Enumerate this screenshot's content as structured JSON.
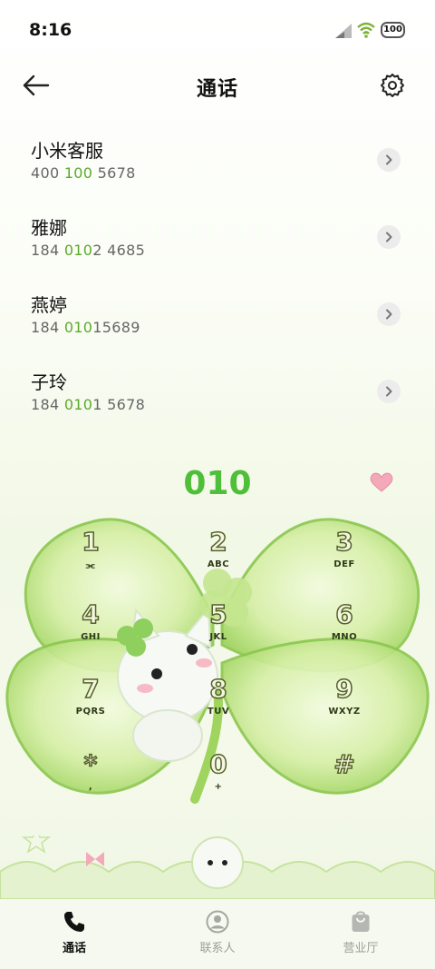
{
  "status_bar": {
    "time": "8:16",
    "battery": "100"
  },
  "header": {
    "title": "通话"
  },
  "contacts": [
    {
      "name": "小米客服",
      "number_pre": "400 ",
      "number_hl": "100",
      "number_post": " 5678"
    },
    {
      "name": "雅娜",
      "number_pre": "184 ",
      "number_hl": "010",
      "number_post": "2 4685"
    },
    {
      "name": "燕婷",
      "number_pre": "184 ",
      "number_hl": "010",
      "number_post": "15689"
    },
    {
      "name": "子玲",
      "number_pre": "184 ",
      "number_hl": "010",
      "number_post": "1 5678"
    }
  ],
  "dial": {
    "value": "010"
  },
  "keypad": [
    {
      "digit": "1",
      "letters": ""
    },
    {
      "digit": "2",
      "letters": "ABC"
    },
    {
      "digit": "3",
      "letters": "DEF"
    },
    {
      "digit": "4",
      "letters": "GHI"
    },
    {
      "digit": "5",
      "letters": "JKL"
    },
    {
      "digit": "6",
      "letters": "MNO"
    },
    {
      "digit": "7",
      "letters": "PQRS"
    },
    {
      "digit": "8",
      "letters": "TUV"
    },
    {
      "digit": "9",
      "letters": "WXYZ"
    },
    {
      "digit": "*",
      "letters": ","
    },
    {
      "digit": "0",
      "letters": "+"
    },
    {
      "digit": "#",
      "letters": ""
    }
  ],
  "tabs": [
    {
      "label": "通话",
      "icon": "phone-icon",
      "active": true
    },
    {
      "label": "联系人",
      "icon": "contact-icon",
      "active": false
    },
    {
      "label": "营业厅",
      "icon": "shopping-bag-icon",
      "active": false
    }
  ],
  "colors": {
    "accent": "#4fbf3a",
    "highlight": "#5aaa2a",
    "clover": "#b9e07a"
  }
}
